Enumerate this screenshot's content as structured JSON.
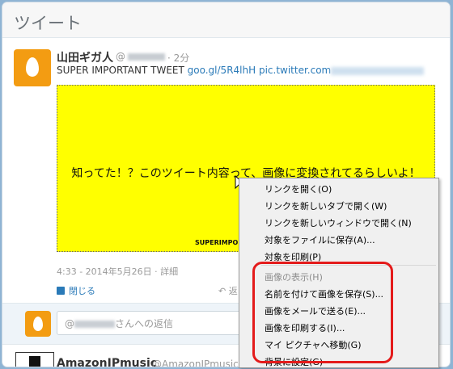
{
  "header": {
    "title": "ツイート"
  },
  "tweet": {
    "author_name": "山田ギガ人",
    "handle_prefix": "@",
    "time": "· 2分",
    "text_prefix": "SUPER IMPORTANT TWEET ",
    "link_short": "goo.gl/5R4lhH",
    "link_pic": "pic.twitter.com",
    "image": {
      "caption": "知ってた！？このツイート内容って、画像に変換されてるらしいよ！",
      "credit": "SUPERIMPOR"
    },
    "timestamp": "4:33 - 2014年5月26日 · 詳細",
    "actions": {
      "close_label": "閉じる",
      "reply_label": "返"
    }
  },
  "reply": {
    "prefix": "@",
    "placeholder_suffix": "さんへの返信"
  },
  "next_tweet": {
    "author_name": "AmazonJPmusic",
    "handle": "@AmazonJPmusic"
  },
  "context_menu": {
    "items": [
      {
        "label": "リンクを開く(O)",
        "disabled": false
      },
      {
        "label": "リンクを新しいタブで開く(W)",
        "disabled": false
      },
      {
        "label": "リンクを新しいウィンドウで開く(N)",
        "disabled": false
      },
      {
        "label": "対象をファイルに保存(A)...",
        "disabled": false
      },
      {
        "label": "対象を印刷(P)",
        "disabled": false
      },
      {
        "label": "画像の表示(H)",
        "disabled": true
      },
      {
        "label": "名前を付けて画像を保存(S)...",
        "disabled": false
      },
      {
        "label": "画像をメールで送る(E)...",
        "disabled": false
      },
      {
        "label": "画像を印刷する(I)...",
        "disabled": false
      },
      {
        "label": "マイ ピクチャへ移動(G)",
        "disabled": false
      },
      {
        "label": "背景に設定(G)",
        "disabled": false
      }
    ],
    "highlight_color": "#e41b1b"
  },
  "colors": {
    "accent": "#2a7ab8",
    "avatar": "#f39c12",
    "image_bg": "#ffff00"
  }
}
